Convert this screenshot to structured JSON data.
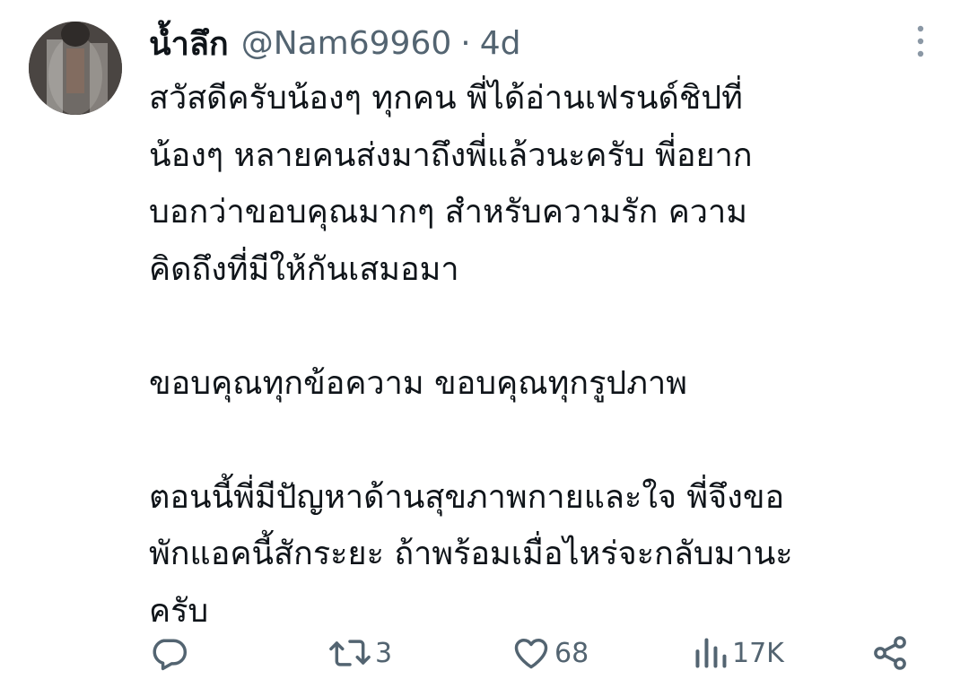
{
  "tweet": {
    "author": {
      "display_name": "น้ำลึก",
      "handle": "@Nam69960",
      "separator": "·",
      "time": "4d",
      "avatar_icon": "avatar-photo"
    },
    "text_lines": [
      "สวัสดีครับน้องๆ ทุกคน พี่ได้อ่านเฟรนด์ชิปที่",
      "น้องๆ หลายคนส่งมาถึงพี่แล้วนะครับ พี่อยาก",
      "บอกว่าขอบคุณมากๆ สำหรับความรัก ความ",
      "คิดถึงที่มีให้กันเสมอมา",
      "",
      "ขอบคุณทุกข้อความ ขอบคุณทุกรูปภาพ",
      "",
      "ตอนนี้พี่มีปัญหาด้านสุขภาพกายและใจ พี่จึงขอ",
      "พักแอคนี้สักระยะ ถ้าพร้อมเมื่อไหร่จะกลับมานะ",
      "ครับ"
    ],
    "actions": {
      "reply": {
        "icon": "reply-icon",
        "count": ""
      },
      "retweet": {
        "icon": "retweet-icon",
        "count": "3"
      },
      "like": {
        "icon": "heart-icon",
        "count": "68"
      },
      "views": {
        "icon": "views-icon",
        "count": "17K"
      },
      "share": {
        "icon": "share-icon",
        "count": ""
      }
    },
    "more_icon": "more-vertical-icon"
  },
  "colors": {
    "text_primary": "#0f1419",
    "text_secondary": "#536471",
    "background": "#ffffff"
  }
}
